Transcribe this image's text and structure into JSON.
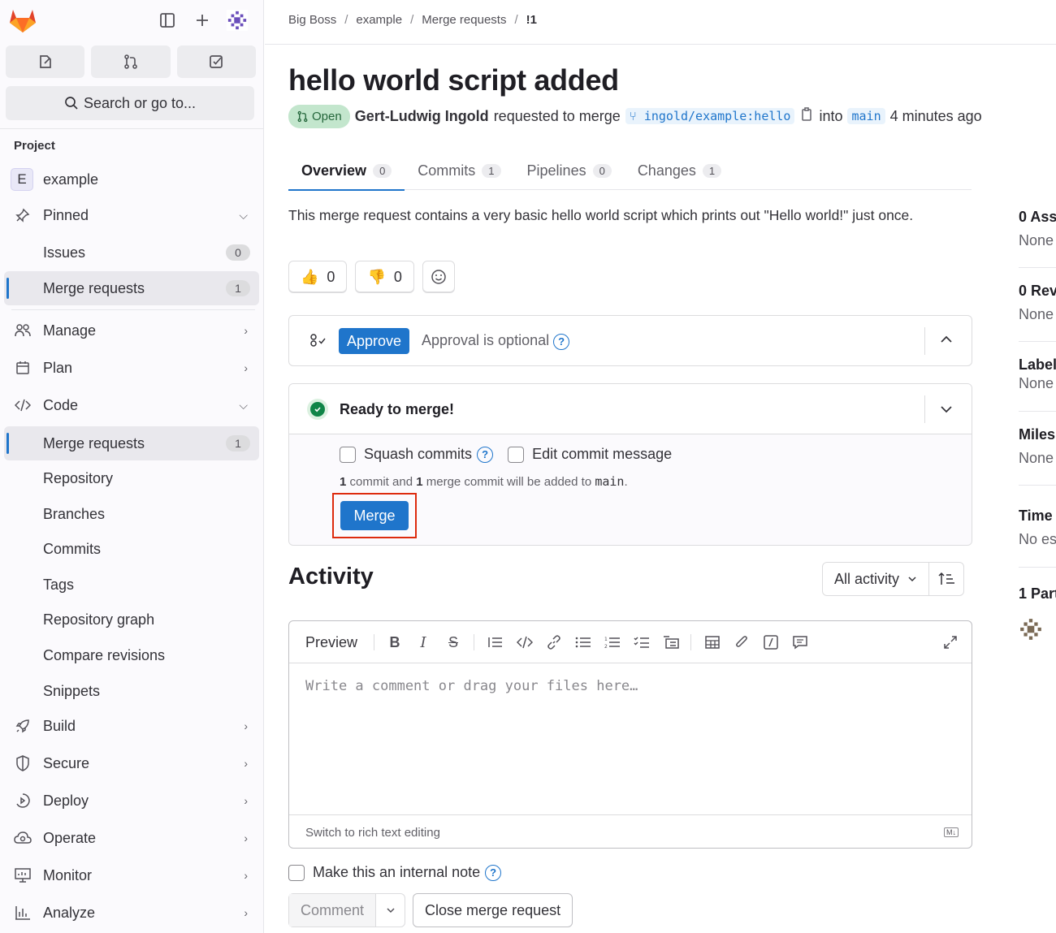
{
  "sidebar": {
    "search_label": "Search or go to...",
    "section_label": "Project",
    "project": {
      "avatar_letter": "E",
      "name": "example"
    },
    "pinned": {
      "label": "Pinned",
      "items": [
        {
          "label": "Issues",
          "count": "0"
        },
        {
          "label": "Merge requests",
          "count": "1"
        }
      ]
    },
    "groups": [
      {
        "label": "Manage",
        "icon": "manage-icon"
      },
      {
        "label": "Plan",
        "icon": "plan-icon"
      },
      {
        "label": "Code",
        "icon": "code-icon"
      }
    ],
    "code_items": [
      {
        "label": "Merge requests",
        "count": "1"
      },
      {
        "label": "Repository"
      },
      {
        "label": "Branches"
      },
      {
        "label": "Commits"
      },
      {
        "label": "Tags"
      },
      {
        "label": "Repository graph"
      },
      {
        "label": "Compare revisions"
      },
      {
        "label": "Snippets"
      }
    ],
    "lower_groups": [
      {
        "label": "Build",
        "icon": "rocket-icon"
      },
      {
        "label": "Secure",
        "icon": "shield-icon"
      },
      {
        "label": "Deploy",
        "icon": "deploy-icon"
      },
      {
        "label": "Operate",
        "icon": "cloud-gear-icon"
      },
      {
        "label": "Monitor",
        "icon": "monitor-icon"
      },
      {
        "label": "Analyze",
        "icon": "chart-icon"
      }
    ]
  },
  "breadcrumb": [
    "Big Boss",
    "example",
    "Merge requests",
    "!1"
  ],
  "mr": {
    "title": "hello world script added",
    "status": "Open",
    "author": "Gert-Ludwig Ingold",
    "requested_text": "requested to merge",
    "source_ref": "ingold/example:hello",
    "into_text": "into",
    "target_ref": "main",
    "time_ago": "4 minutes ago",
    "description": "This merge request contains a very basic hello world script which prints out \"Hello world!\" just once."
  },
  "tabs": [
    {
      "label": "Overview",
      "count": "0",
      "active": true
    },
    {
      "label": "Commits",
      "count": "1"
    },
    {
      "label": "Pipelines",
      "count": "0"
    },
    {
      "label": "Changes",
      "count": "1"
    }
  ],
  "reactions": {
    "thumbs_up": "0",
    "thumbs_down": "0"
  },
  "approval": {
    "button": "Approve",
    "text": "Approval is optional"
  },
  "merge": {
    "title": "Ready to merge!",
    "squash_label": "Squash commits",
    "edit_msg_label": "Edit commit message",
    "info_commits": "1",
    "info_mid": "commit and",
    "info_merge_commits": "1",
    "info_end": "merge commit will be added to",
    "info_branch": "main",
    "button": "Merge"
  },
  "activity": {
    "title": "Activity",
    "filter": "All activity",
    "editor": {
      "preview": "Preview",
      "placeholder": "Write a comment or drag your files here…",
      "switch_rich": "Switch to rich text editing",
      "md_badge": "M↓"
    },
    "internal_note": "Make this an internal note",
    "comment_button": "Comment",
    "close_button": "Close merge request"
  },
  "right_sidebar": [
    {
      "title": "0 Ass",
      "value": "None"
    },
    {
      "title": "0 Rev",
      "value": "None"
    },
    {
      "title": "Label",
      "value": "None"
    },
    {
      "title": "Miles",
      "value": "None"
    },
    {
      "title": "Time",
      "value": "No es"
    },
    {
      "title": "1 Part",
      "value": ""
    }
  ],
  "colors": {
    "accent": "#1f75cb",
    "open_badge_bg": "#c3e6cd",
    "open_badge_fg": "#24663b",
    "success": "#108548",
    "highlight_frame": "#dd2b0e"
  }
}
